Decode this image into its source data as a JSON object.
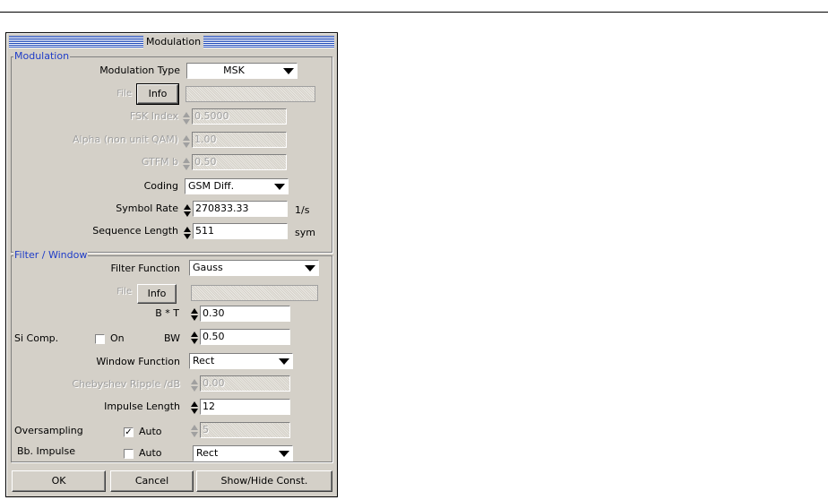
{
  "window": {
    "title": "Modulation"
  },
  "modulation": {
    "group_label": "Modulation",
    "type_label": "Modulation Type",
    "type_value": "MSK",
    "file_label": "File",
    "info_label": "Info",
    "fsk_index_label": "FSK Index",
    "fsk_index_value": "0.5000",
    "alpha_label": "Alpha (non unit QAM)",
    "alpha_value": "1.00",
    "gtfm_label": "GTFM b",
    "gtfm_value": "0.50",
    "coding_label": "Coding",
    "coding_value": "GSM Diff.",
    "symbol_rate_label": "Symbol  Rate",
    "symbol_rate_value": "270833.33",
    "symbol_rate_unit": "1/s",
    "seq_length_label": "Sequence Length",
    "seq_length_value": "511",
    "seq_length_unit": "sym"
  },
  "filter": {
    "group_label": "Filter / Window",
    "function_label": "Filter Function",
    "function_value": "Gauss",
    "file_label": "File",
    "info_label": "Info",
    "bt_label": "B * T",
    "bt_value": "0.30",
    "si_comp_label": "Si Comp.",
    "on_label": "On",
    "on_checked": false,
    "bw_label": "BW",
    "bw_value": "0.50",
    "window_function_label": "Window Function",
    "window_function_value": "Rect",
    "cheby_label": "Chebyshev Ripple /dB",
    "cheby_value": "0.00",
    "impulse_length_label": "Impulse Length",
    "impulse_length_value": "12",
    "oversampling_label": "Oversampling",
    "oversampling_auto_label": "Auto",
    "oversampling_auto_checked": true,
    "oversampling_value": "5",
    "bb_impulse_label": "Bb. Impulse",
    "bb_auto_label": "Auto",
    "bb_auto_checked": false,
    "bb_impulse_value": "Rect"
  },
  "buttons": {
    "ok": "OK",
    "cancel": "Cancel",
    "show_hide": "Show/Hide Const."
  },
  "check_mark": "✓"
}
